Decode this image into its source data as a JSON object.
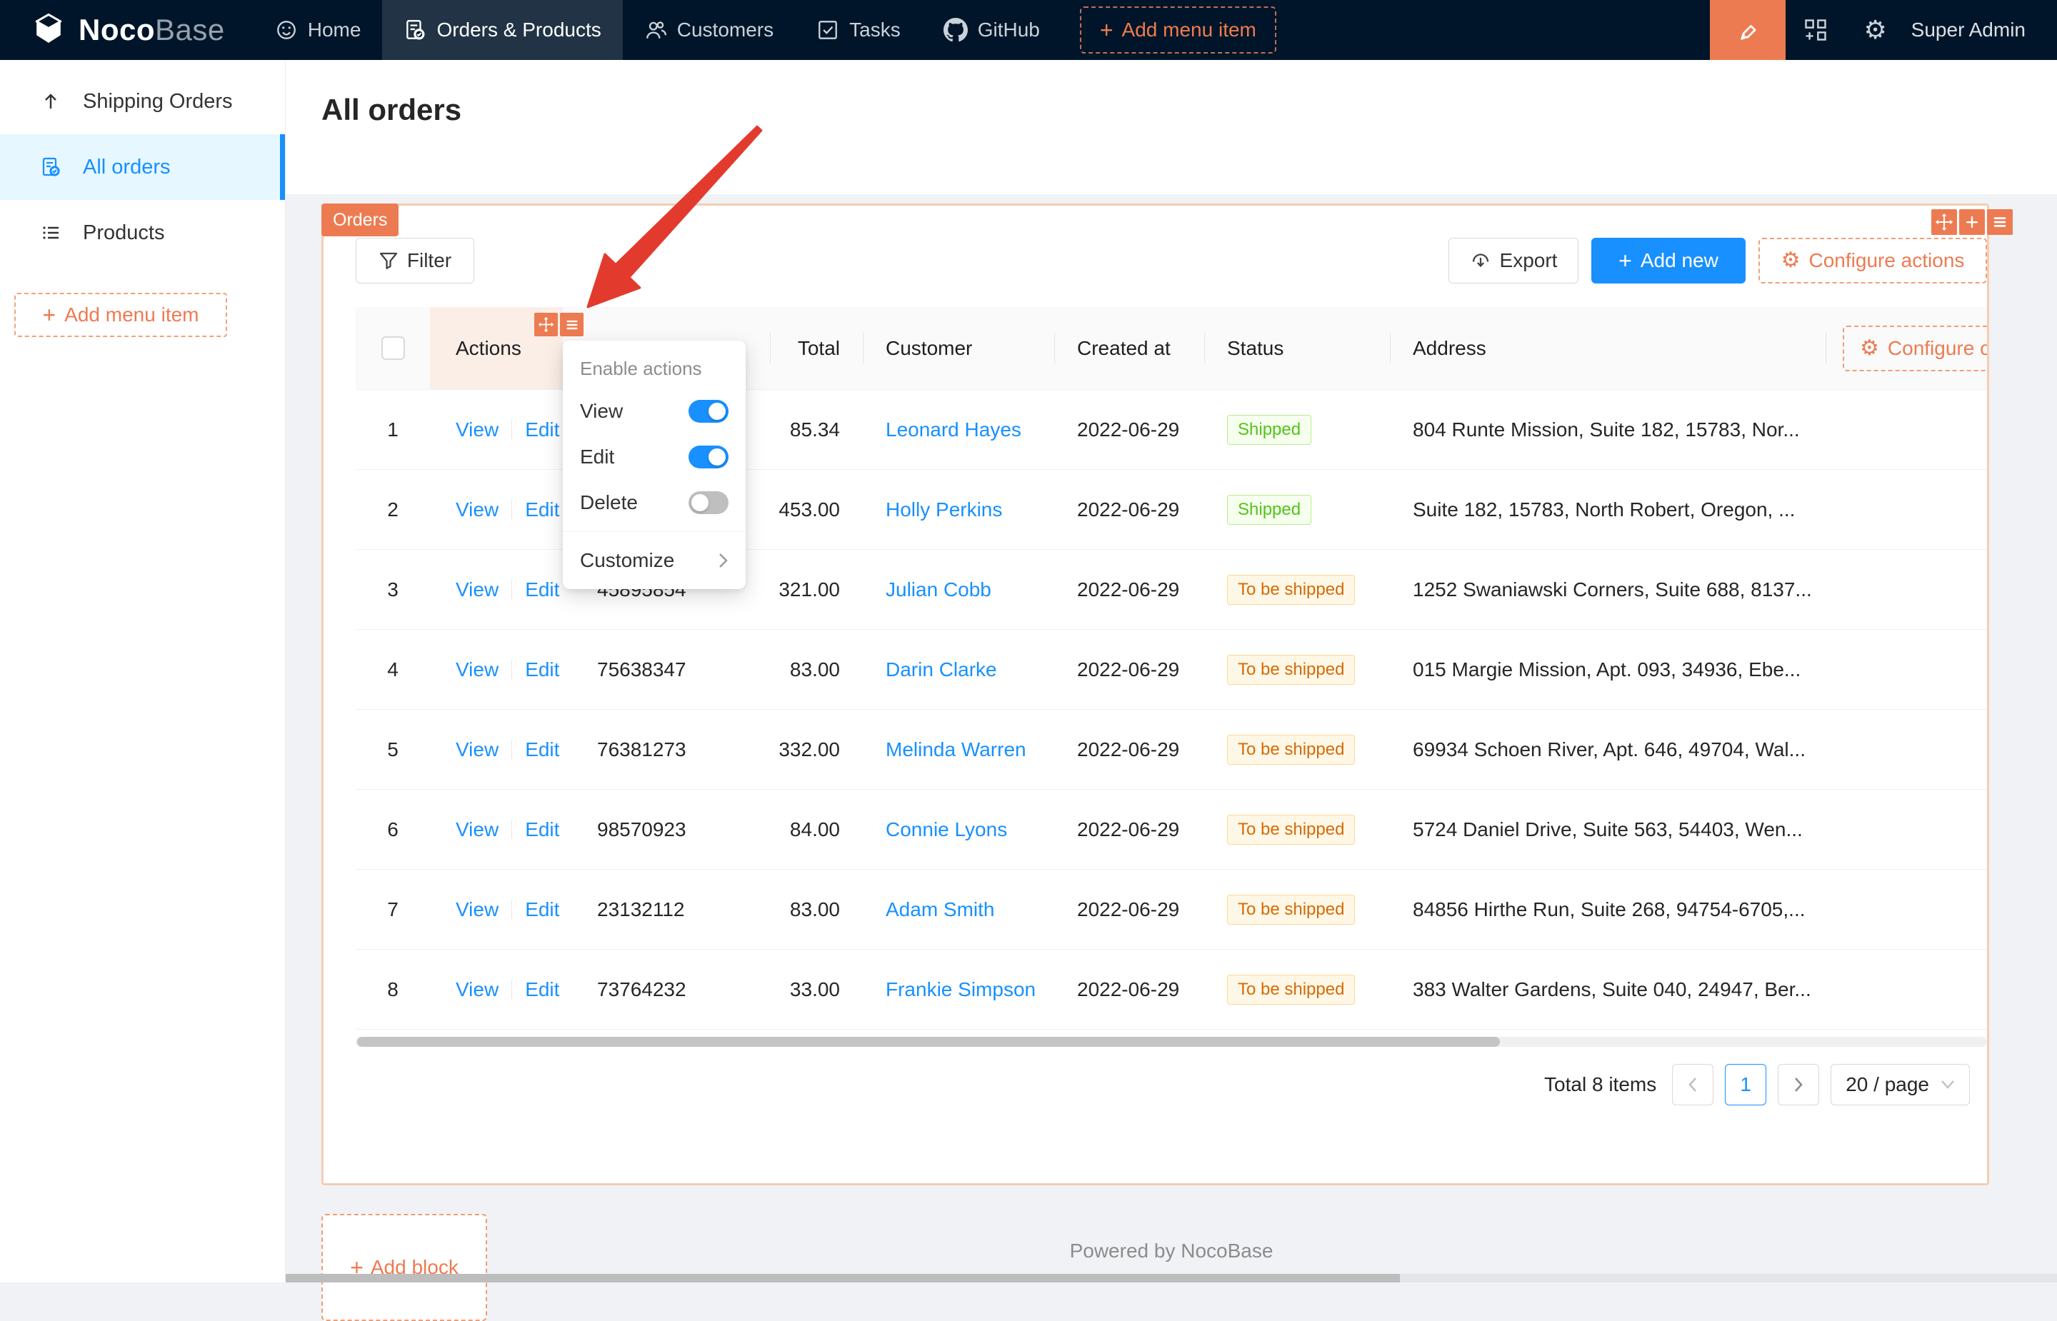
{
  "colors": {
    "accent_orange": "#ED7B52",
    "primary_blue": "#1890FF",
    "nav_navy": "#001529",
    "arrow_red": "#E23B2E",
    "badge_green_text": "#52C41A",
    "badge_orange_text": "#D46B08"
  },
  "topnav": {
    "brand_bold": "Noco",
    "brand_light": "Base",
    "items": [
      {
        "label": "Home",
        "icon": "smile-icon",
        "active": false
      },
      {
        "label": "Orders & Products",
        "icon": "file-done-icon",
        "active": true
      },
      {
        "label": "Customers",
        "icon": "team-icon",
        "active": false
      },
      {
        "label": "Tasks",
        "icon": "check-square-icon",
        "active": false
      },
      {
        "label": "GitHub",
        "icon": "github-icon",
        "active": false
      }
    ],
    "add_menu_label": "Add menu item",
    "user": "Super Admin"
  },
  "sidebar": {
    "items": [
      {
        "label": "Shipping Orders",
        "icon": "arrow-up-icon",
        "active": false
      },
      {
        "label": "All orders",
        "icon": "file-done-icon",
        "active": true
      },
      {
        "label": "Products",
        "icon": "list-icon",
        "active": false
      }
    ],
    "add_menu_label": "Add menu item"
  },
  "page": {
    "title": "All orders",
    "add_block_label": "Add block",
    "powered_by": "Powered by NocoBase"
  },
  "orders_block": {
    "tag": "Orders",
    "toolbar": {
      "filter": "Filter",
      "export": "Export",
      "add_new": "Add new",
      "configure_actions": "Configure actions"
    },
    "table": {
      "columns": [
        "",
        "Actions",
        "",
        "Total",
        "Customer",
        "Created at",
        "Status",
        "Address",
        ""
      ],
      "configure_columns_label": "Configure columns",
      "action_links": [
        "View",
        "Edit"
      ],
      "rows": [
        {
          "index": "1",
          "order_no": "",
          "total": "85.34",
          "customer": "Leonard Hayes",
          "created_at": "2022-06-29",
          "status": "Shipped",
          "status_color": "green",
          "address": "804 Runte Mission, Suite 182, 15783, Nor..."
        },
        {
          "index": "2",
          "order_no": "",
          "total": "453.00",
          "customer": "Holly Perkins",
          "created_at": "2022-06-29",
          "status": "Shipped",
          "status_color": "green",
          "address": "Suite 182, 15783, North Robert, Oregon, ..."
        },
        {
          "index": "3",
          "order_no": "45895854",
          "total": "321.00",
          "customer": "Julian Cobb",
          "created_at": "2022-06-29",
          "status": "To be shipped",
          "status_color": "orange",
          "address": "1252 Swaniawski Corners, Suite 688, 8137..."
        },
        {
          "index": "4",
          "order_no": "75638347",
          "total": "83.00",
          "customer": "Darin Clarke",
          "created_at": "2022-06-29",
          "status": "To be shipped",
          "status_color": "orange",
          "address": "015 Margie Mission, Apt. 093, 34936, Ebe..."
        },
        {
          "index": "5",
          "order_no": "76381273",
          "total": "332.00",
          "customer": "Melinda Warren",
          "created_at": "2022-06-29",
          "status": "To be shipped",
          "status_color": "orange",
          "address": "69934 Schoen River, Apt. 646, 49704, Wal..."
        },
        {
          "index": "6",
          "order_no": "98570923",
          "total": "84.00",
          "customer": "Connie Lyons",
          "created_at": "2022-06-29",
          "status": "To be shipped",
          "status_color": "orange",
          "address": "5724 Daniel Drive, Suite 563, 54403, Wen..."
        },
        {
          "index": "7",
          "order_no": "23132112",
          "total": "83.00",
          "customer": "Adam Smith",
          "created_at": "2022-06-29",
          "status": "To be shipped",
          "status_color": "orange",
          "address": "84856 Hirthe Run, Suite 268, 94754-6705,..."
        },
        {
          "index": "8",
          "order_no": "73764232",
          "total": "33.00",
          "customer": "Frankie Simpson",
          "created_at": "2022-06-29",
          "status": "To be shipped",
          "status_color": "orange",
          "address": "383 Walter Gardens, Suite 040, 24947, Ber..."
        }
      ]
    },
    "pagination": {
      "total_text": "Total 8 items",
      "current_page": "1",
      "page_size": "20 / page"
    }
  },
  "dropdown": {
    "header": "Enable actions",
    "items": [
      {
        "label": "View",
        "on": true
      },
      {
        "label": "Edit",
        "on": true
      },
      {
        "label": "Delete",
        "on": false
      }
    ],
    "customize": "Customize"
  }
}
